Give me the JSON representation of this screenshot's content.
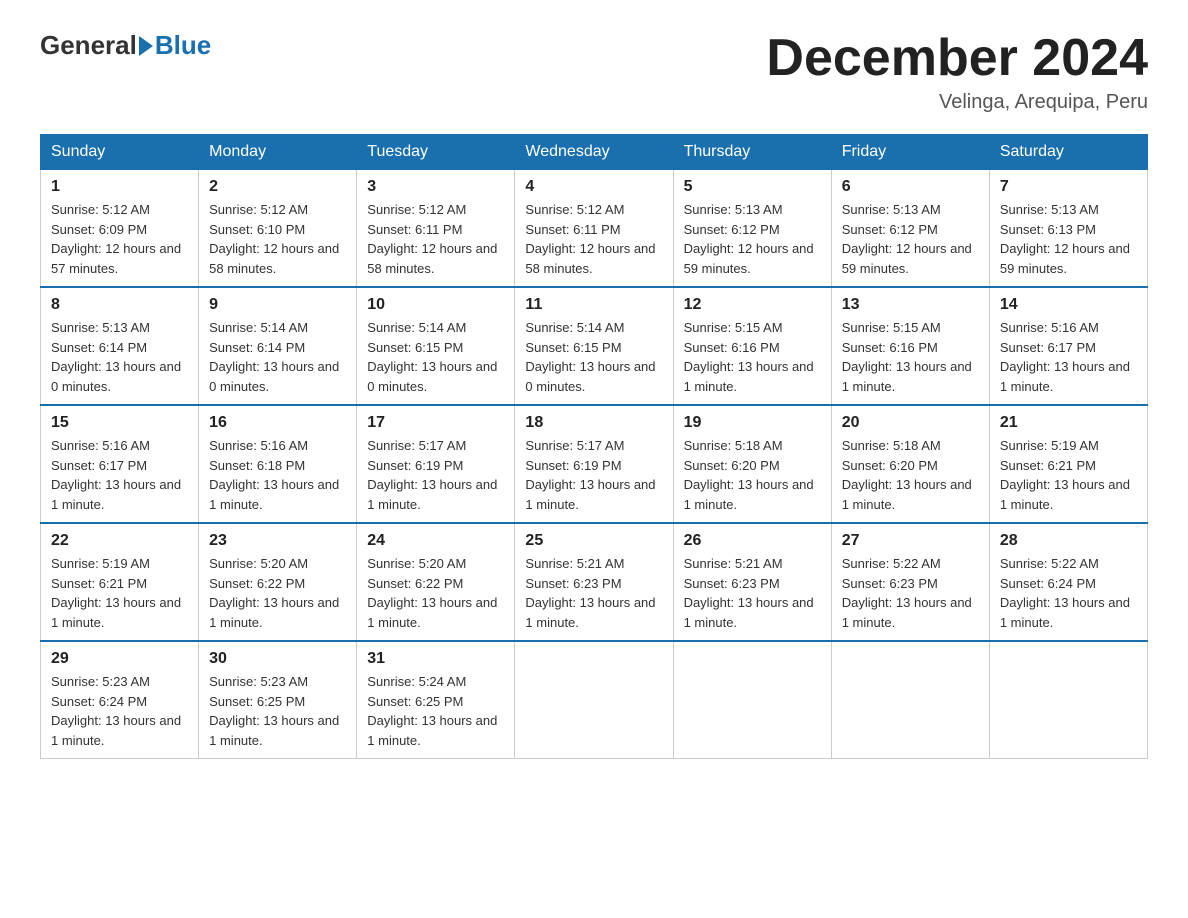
{
  "header": {
    "logo_general": "General",
    "logo_blue": "Blue",
    "month_title": "December 2024",
    "location": "Velinga, Arequipa, Peru"
  },
  "weekdays": [
    "Sunday",
    "Monday",
    "Tuesday",
    "Wednesday",
    "Thursday",
    "Friday",
    "Saturday"
  ],
  "weeks": [
    [
      {
        "day": "1",
        "sunrise": "5:12 AM",
        "sunset": "6:09 PM",
        "daylight": "12 hours and 57 minutes."
      },
      {
        "day": "2",
        "sunrise": "5:12 AM",
        "sunset": "6:10 PM",
        "daylight": "12 hours and 58 minutes."
      },
      {
        "day": "3",
        "sunrise": "5:12 AM",
        "sunset": "6:11 PM",
        "daylight": "12 hours and 58 minutes."
      },
      {
        "day": "4",
        "sunrise": "5:12 AM",
        "sunset": "6:11 PM",
        "daylight": "12 hours and 58 minutes."
      },
      {
        "day": "5",
        "sunrise": "5:13 AM",
        "sunset": "6:12 PM",
        "daylight": "12 hours and 59 minutes."
      },
      {
        "day": "6",
        "sunrise": "5:13 AM",
        "sunset": "6:12 PM",
        "daylight": "12 hours and 59 minutes."
      },
      {
        "day": "7",
        "sunrise": "5:13 AM",
        "sunset": "6:13 PM",
        "daylight": "12 hours and 59 minutes."
      }
    ],
    [
      {
        "day": "8",
        "sunrise": "5:13 AM",
        "sunset": "6:14 PM",
        "daylight": "13 hours and 0 minutes."
      },
      {
        "day": "9",
        "sunrise": "5:14 AM",
        "sunset": "6:14 PM",
        "daylight": "13 hours and 0 minutes."
      },
      {
        "day": "10",
        "sunrise": "5:14 AM",
        "sunset": "6:15 PM",
        "daylight": "13 hours and 0 minutes."
      },
      {
        "day": "11",
        "sunrise": "5:14 AM",
        "sunset": "6:15 PM",
        "daylight": "13 hours and 0 minutes."
      },
      {
        "day": "12",
        "sunrise": "5:15 AM",
        "sunset": "6:16 PM",
        "daylight": "13 hours and 1 minute."
      },
      {
        "day": "13",
        "sunrise": "5:15 AM",
        "sunset": "6:16 PM",
        "daylight": "13 hours and 1 minute."
      },
      {
        "day": "14",
        "sunrise": "5:16 AM",
        "sunset": "6:17 PM",
        "daylight": "13 hours and 1 minute."
      }
    ],
    [
      {
        "day": "15",
        "sunrise": "5:16 AM",
        "sunset": "6:17 PM",
        "daylight": "13 hours and 1 minute."
      },
      {
        "day": "16",
        "sunrise": "5:16 AM",
        "sunset": "6:18 PM",
        "daylight": "13 hours and 1 minute."
      },
      {
        "day": "17",
        "sunrise": "5:17 AM",
        "sunset": "6:19 PM",
        "daylight": "13 hours and 1 minute."
      },
      {
        "day": "18",
        "sunrise": "5:17 AM",
        "sunset": "6:19 PM",
        "daylight": "13 hours and 1 minute."
      },
      {
        "day": "19",
        "sunrise": "5:18 AM",
        "sunset": "6:20 PM",
        "daylight": "13 hours and 1 minute."
      },
      {
        "day": "20",
        "sunrise": "5:18 AM",
        "sunset": "6:20 PM",
        "daylight": "13 hours and 1 minute."
      },
      {
        "day": "21",
        "sunrise": "5:19 AM",
        "sunset": "6:21 PM",
        "daylight": "13 hours and 1 minute."
      }
    ],
    [
      {
        "day": "22",
        "sunrise": "5:19 AM",
        "sunset": "6:21 PM",
        "daylight": "13 hours and 1 minute."
      },
      {
        "day": "23",
        "sunrise": "5:20 AM",
        "sunset": "6:22 PM",
        "daylight": "13 hours and 1 minute."
      },
      {
        "day": "24",
        "sunrise": "5:20 AM",
        "sunset": "6:22 PM",
        "daylight": "13 hours and 1 minute."
      },
      {
        "day": "25",
        "sunrise": "5:21 AM",
        "sunset": "6:23 PM",
        "daylight": "13 hours and 1 minute."
      },
      {
        "day": "26",
        "sunrise": "5:21 AM",
        "sunset": "6:23 PM",
        "daylight": "13 hours and 1 minute."
      },
      {
        "day": "27",
        "sunrise": "5:22 AM",
        "sunset": "6:23 PM",
        "daylight": "13 hours and 1 minute."
      },
      {
        "day": "28",
        "sunrise": "5:22 AM",
        "sunset": "6:24 PM",
        "daylight": "13 hours and 1 minute."
      }
    ],
    [
      {
        "day": "29",
        "sunrise": "5:23 AM",
        "sunset": "6:24 PM",
        "daylight": "13 hours and 1 minute."
      },
      {
        "day": "30",
        "sunrise": "5:23 AM",
        "sunset": "6:25 PM",
        "daylight": "13 hours and 1 minute."
      },
      {
        "day": "31",
        "sunrise": "5:24 AM",
        "sunset": "6:25 PM",
        "daylight": "13 hours and 1 minute."
      },
      null,
      null,
      null,
      null
    ]
  ],
  "labels": {
    "sunrise": "Sunrise:",
    "sunset": "Sunset:",
    "daylight": "Daylight:"
  }
}
